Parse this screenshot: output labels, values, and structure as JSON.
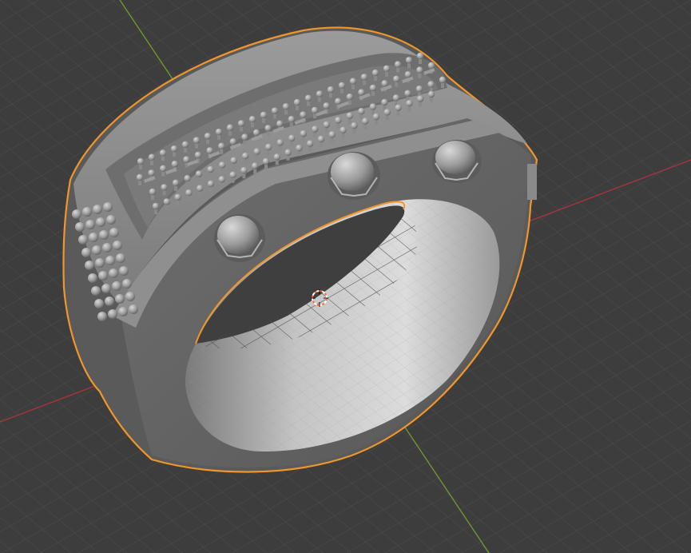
{
  "viewport": {
    "mode": "3D Viewport",
    "background_color": "#3d3d3d",
    "grid_color": "#4d4d4d",
    "x_axis_color": "#a8343c",
    "y_axis_color": "#6a9a2a",
    "selection_outline_color": "#f0962a",
    "mesh_color": "#8c8c8c",
    "cursor_color": "#ff6a2a",
    "objects": [
      {
        "name": "ring",
        "selected": true,
        "active": true
      }
    ]
  }
}
